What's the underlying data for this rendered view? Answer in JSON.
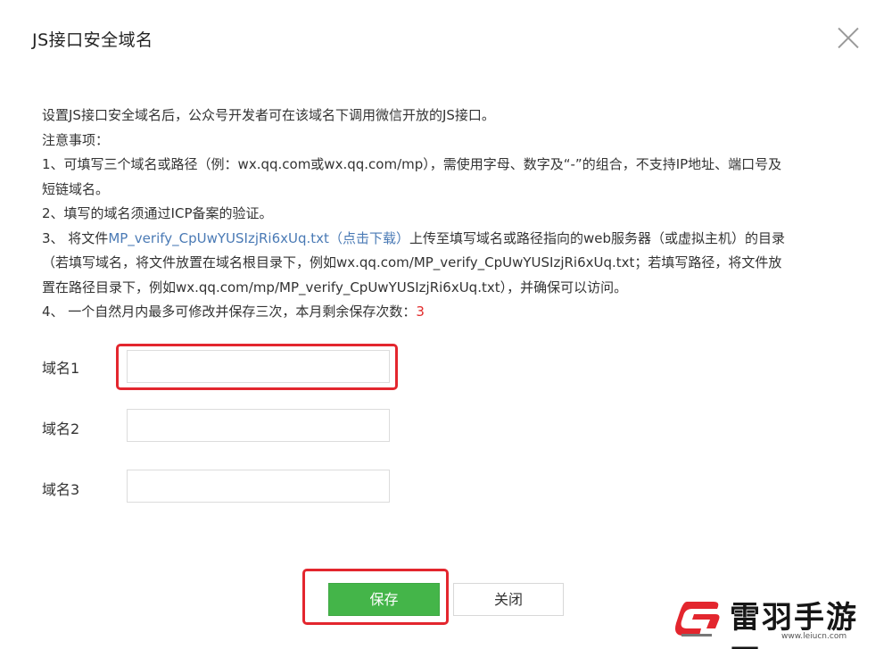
{
  "dialog": {
    "title": "JS接口安全域名",
    "close_label": "×"
  },
  "description": {
    "intro": "设置JS接口安全域名后，公众号开发者可在该域名下调用微信开放的JS接口。",
    "notice_title": "注意事项：",
    "item1_line1": "1、可填写三个域名或路径（例：wx.qq.com或wx.qq.com/mp），需使用字母、数字及“-”的组合，不支持IP地址、端口号及",
    "item1_line2": "短链域名。",
    "item2": "2、填写的域名须通过ICP备案的验证。",
    "item3_prefix": "3、 将文件",
    "item3_file": "MP_verify_CpUwYUSIzjRi6xUq.txt",
    "item3_download": "（点击下载）",
    "item3_suffix": "上传至填写域名或路径指向的web服务器（或虚拟主机）的目录",
    "item3_line2": "（若填写域名，将文件放置在域名根目录下，例如wx.qq.com/MP_verify_CpUwYUSIzjRi6xUq.txt；若填写路径，将文件放",
    "item3_line3": "置在路径目录下，例如wx.qq.com/mp/MP_verify_CpUwYUSIzjRi6xUq.txt），并确保可以访问。",
    "item4_prefix": "4、 一个自然月内最多可修改并保存三次，本月剩余保存次数：",
    "item4_count": "3"
  },
  "form": {
    "domain1_label": "域名1",
    "domain1_value": "",
    "domain2_label": "域名2",
    "domain2_value": "",
    "domain3_label": "域名3",
    "domain3_value": ""
  },
  "buttons": {
    "save_label": "保存",
    "close_label": "关闭"
  },
  "watermark": {
    "brand": "雷羽手游网",
    "url": "www.leiucn.com"
  },
  "colors": {
    "save_button": "#44b549",
    "highlight": "#e3262e",
    "link": "#4a7ab5",
    "count": "#e12b2b"
  }
}
